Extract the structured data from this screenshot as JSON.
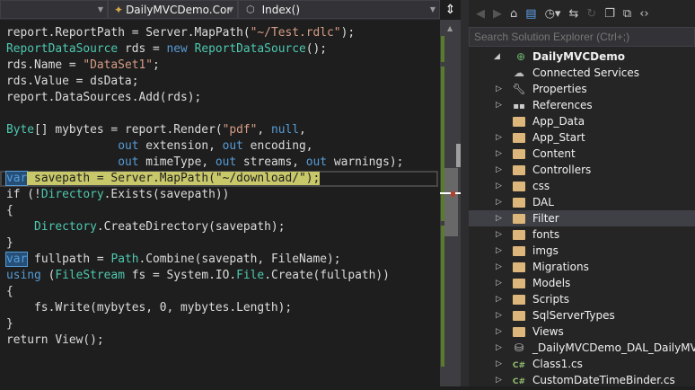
{
  "navbar": {
    "project_dd": "",
    "class_dd": "DailyMVCDemo.Controllers.Generat",
    "member_dd": "Index()"
  },
  "code": [
    [
      [
        "report",
        "pl"
      ],
      [
        ".",
        "pl"
      ],
      [
        "ReportPath",
        "pl"
      ],
      [
        " = Server.MapPath(",
        "pl"
      ],
      [
        "\"~/Test.rdlc\"",
        "st"
      ],
      [
        ");",
        "pl"
      ]
    ],
    [
      [
        "ReportDataSource",
        "ty"
      ],
      [
        " rds = ",
        "pl"
      ],
      [
        "new",
        "kw"
      ],
      [
        " ",
        "pl"
      ],
      [
        "ReportDataSource",
        "ty"
      ],
      [
        "();",
        "pl"
      ]
    ],
    [
      [
        "rds.Name = ",
        "pl"
      ],
      [
        "\"DataSet1\"",
        "st"
      ],
      [
        ";",
        "pl"
      ]
    ],
    [
      [
        "rds.Value = dsData;",
        "pl"
      ]
    ],
    [
      [
        "report.DataSources.Add(rds);",
        "pl"
      ]
    ],
    [],
    [
      [
        "Byte",
        "ty"
      ],
      [
        "[] mybytes = report.Render(",
        "pl"
      ],
      [
        "\"pdf\"",
        "st"
      ],
      [
        ", ",
        "pl"
      ],
      [
        "null",
        "kw"
      ],
      [
        ",",
        "pl"
      ]
    ],
    [
      [
        "                ",
        "pl"
      ],
      [
        "out",
        "kw"
      ],
      [
        " extension, ",
        "pl"
      ],
      [
        "out",
        "kw"
      ],
      [
        " encoding,",
        "pl"
      ]
    ],
    [
      [
        "                ",
        "pl"
      ],
      [
        "out",
        "kw"
      ],
      [
        " mimeType, ",
        "pl"
      ],
      [
        "out",
        "kw"
      ],
      [
        " streams, ",
        "pl"
      ],
      [
        "out",
        "kw"
      ],
      [
        " warnings);",
        "pl"
      ]
    ],
    [
      [
        "var",
        "hlv"
      ],
      [
        " savepath = Server.MapPath(\"~/download/\");",
        "hl"
      ]
    ],
    [
      [
        "if (!",
        "pl"
      ],
      [
        "Directory",
        "ty"
      ],
      [
        ".Exists(savepath))",
        "pl"
      ]
    ],
    [
      [
        "{",
        "pl"
      ]
    ],
    [
      [
        "    ",
        "pl"
      ],
      [
        "Directory",
        "ty"
      ],
      [
        ".CreateDirectory(savepath);",
        "pl"
      ]
    ],
    [
      [
        "}",
        "pl"
      ]
    ],
    [
      [
        "var",
        "hlv"
      ],
      [
        " fullpath = ",
        "pl"
      ],
      [
        "Path",
        "ty"
      ],
      [
        ".Combine(savepath, FileName);",
        "pl"
      ]
    ],
    [
      [
        "using",
        "kw"
      ],
      [
        " (",
        "pl"
      ],
      [
        "FileStream",
        "ty"
      ],
      [
        " fs = System.IO.",
        "pl"
      ],
      [
        "File",
        "ty"
      ],
      [
        ".Create(fullpath))",
        "pl"
      ]
    ],
    [
      [
        "{",
        "pl"
      ]
    ],
    [
      [
        "    fs.Write(mybytes, 0, mybytes.Length);",
        "pl"
      ]
    ],
    [
      [
        "}",
        "pl"
      ]
    ],
    [
      [
        "return View();",
        "pl"
      ]
    ]
  ],
  "solution_explorer": {
    "search_placeholder": "Search Solution Explorer (Ctrl+;)",
    "items": [
      {
        "label": "DailyMVCDemo",
        "icon": "web-project-icon",
        "expander": "expanded",
        "level": 0,
        "bold": true
      },
      {
        "label": "Connected Services",
        "icon": "connected-services-icon",
        "expander": "none",
        "level": 1
      },
      {
        "label": "Properties",
        "icon": "wrench-icon",
        "expander": "collapsed",
        "level": 1
      },
      {
        "label": "References",
        "icon": "references-icon",
        "expander": "collapsed",
        "level": 1
      },
      {
        "label": "App_Data",
        "icon": "folder-icon",
        "expander": "none",
        "level": 1
      },
      {
        "label": "App_Start",
        "icon": "folder-icon",
        "expander": "collapsed",
        "level": 1
      },
      {
        "label": "Content",
        "icon": "folder-icon",
        "expander": "collapsed",
        "level": 1
      },
      {
        "label": "Controllers",
        "icon": "folder-icon",
        "expander": "collapsed",
        "level": 1
      },
      {
        "label": "css",
        "icon": "folder-icon",
        "expander": "collapsed",
        "level": 1
      },
      {
        "label": "DAL",
        "icon": "folder-icon",
        "expander": "collapsed",
        "level": 1
      },
      {
        "label": "Filter",
        "icon": "folder-icon",
        "expander": "collapsed",
        "level": 1,
        "selected": true
      },
      {
        "label": "fonts",
        "icon": "folder-icon",
        "expander": "collapsed",
        "level": 1
      },
      {
        "label": "imgs",
        "icon": "folder-icon",
        "expander": "collapsed",
        "level": 1
      },
      {
        "label": "Migrations",
        "icon": "folder-icon",
        "expander": "collapsed",
        "level": 1
      },
      {
        "label": "Models",
        "icon": "folder-icon",
        "expander": "collapsed",
        "level": 1
      },
      {
        "label": "Scripts",
        "icon": "folder-icon",
        "expander": "collapsed",
        "level": 1
      },
      {
        "label": "SqlServerTypes",
        "icon": "folder-icon",
        "expander": "collapsed",
        "level": 1
      },
      {
        "label": "Views",
        "icon": "folder-icon",
        "expander": "collapsed",
        "level": 1
      },
      {
        "label": "_DailyMVCDemo_DAL_DailyMVCD",
        "icon": "database-icon",
        "expander": "collapsed",
        "level": 1
      },
      {
        "label": "Class1.cs",
        "icon": "csharp-file-icon",
        "expander": "collapsed",
        "level": 1
      },
      {
        "label": "CustomDateTimeBinder.cs",
        "icon": "csharp-file-icon",
        "expander": "collapsed",
        "level": 1
      }
    ]
  },
  "colors": {
    "keyword": "#569cd6",
    "type": "#4ec9b0",
    "string": "#d69d85",
    "highlight": "#c8c86a",
    "selection": "#3f3f46"
  }
}
